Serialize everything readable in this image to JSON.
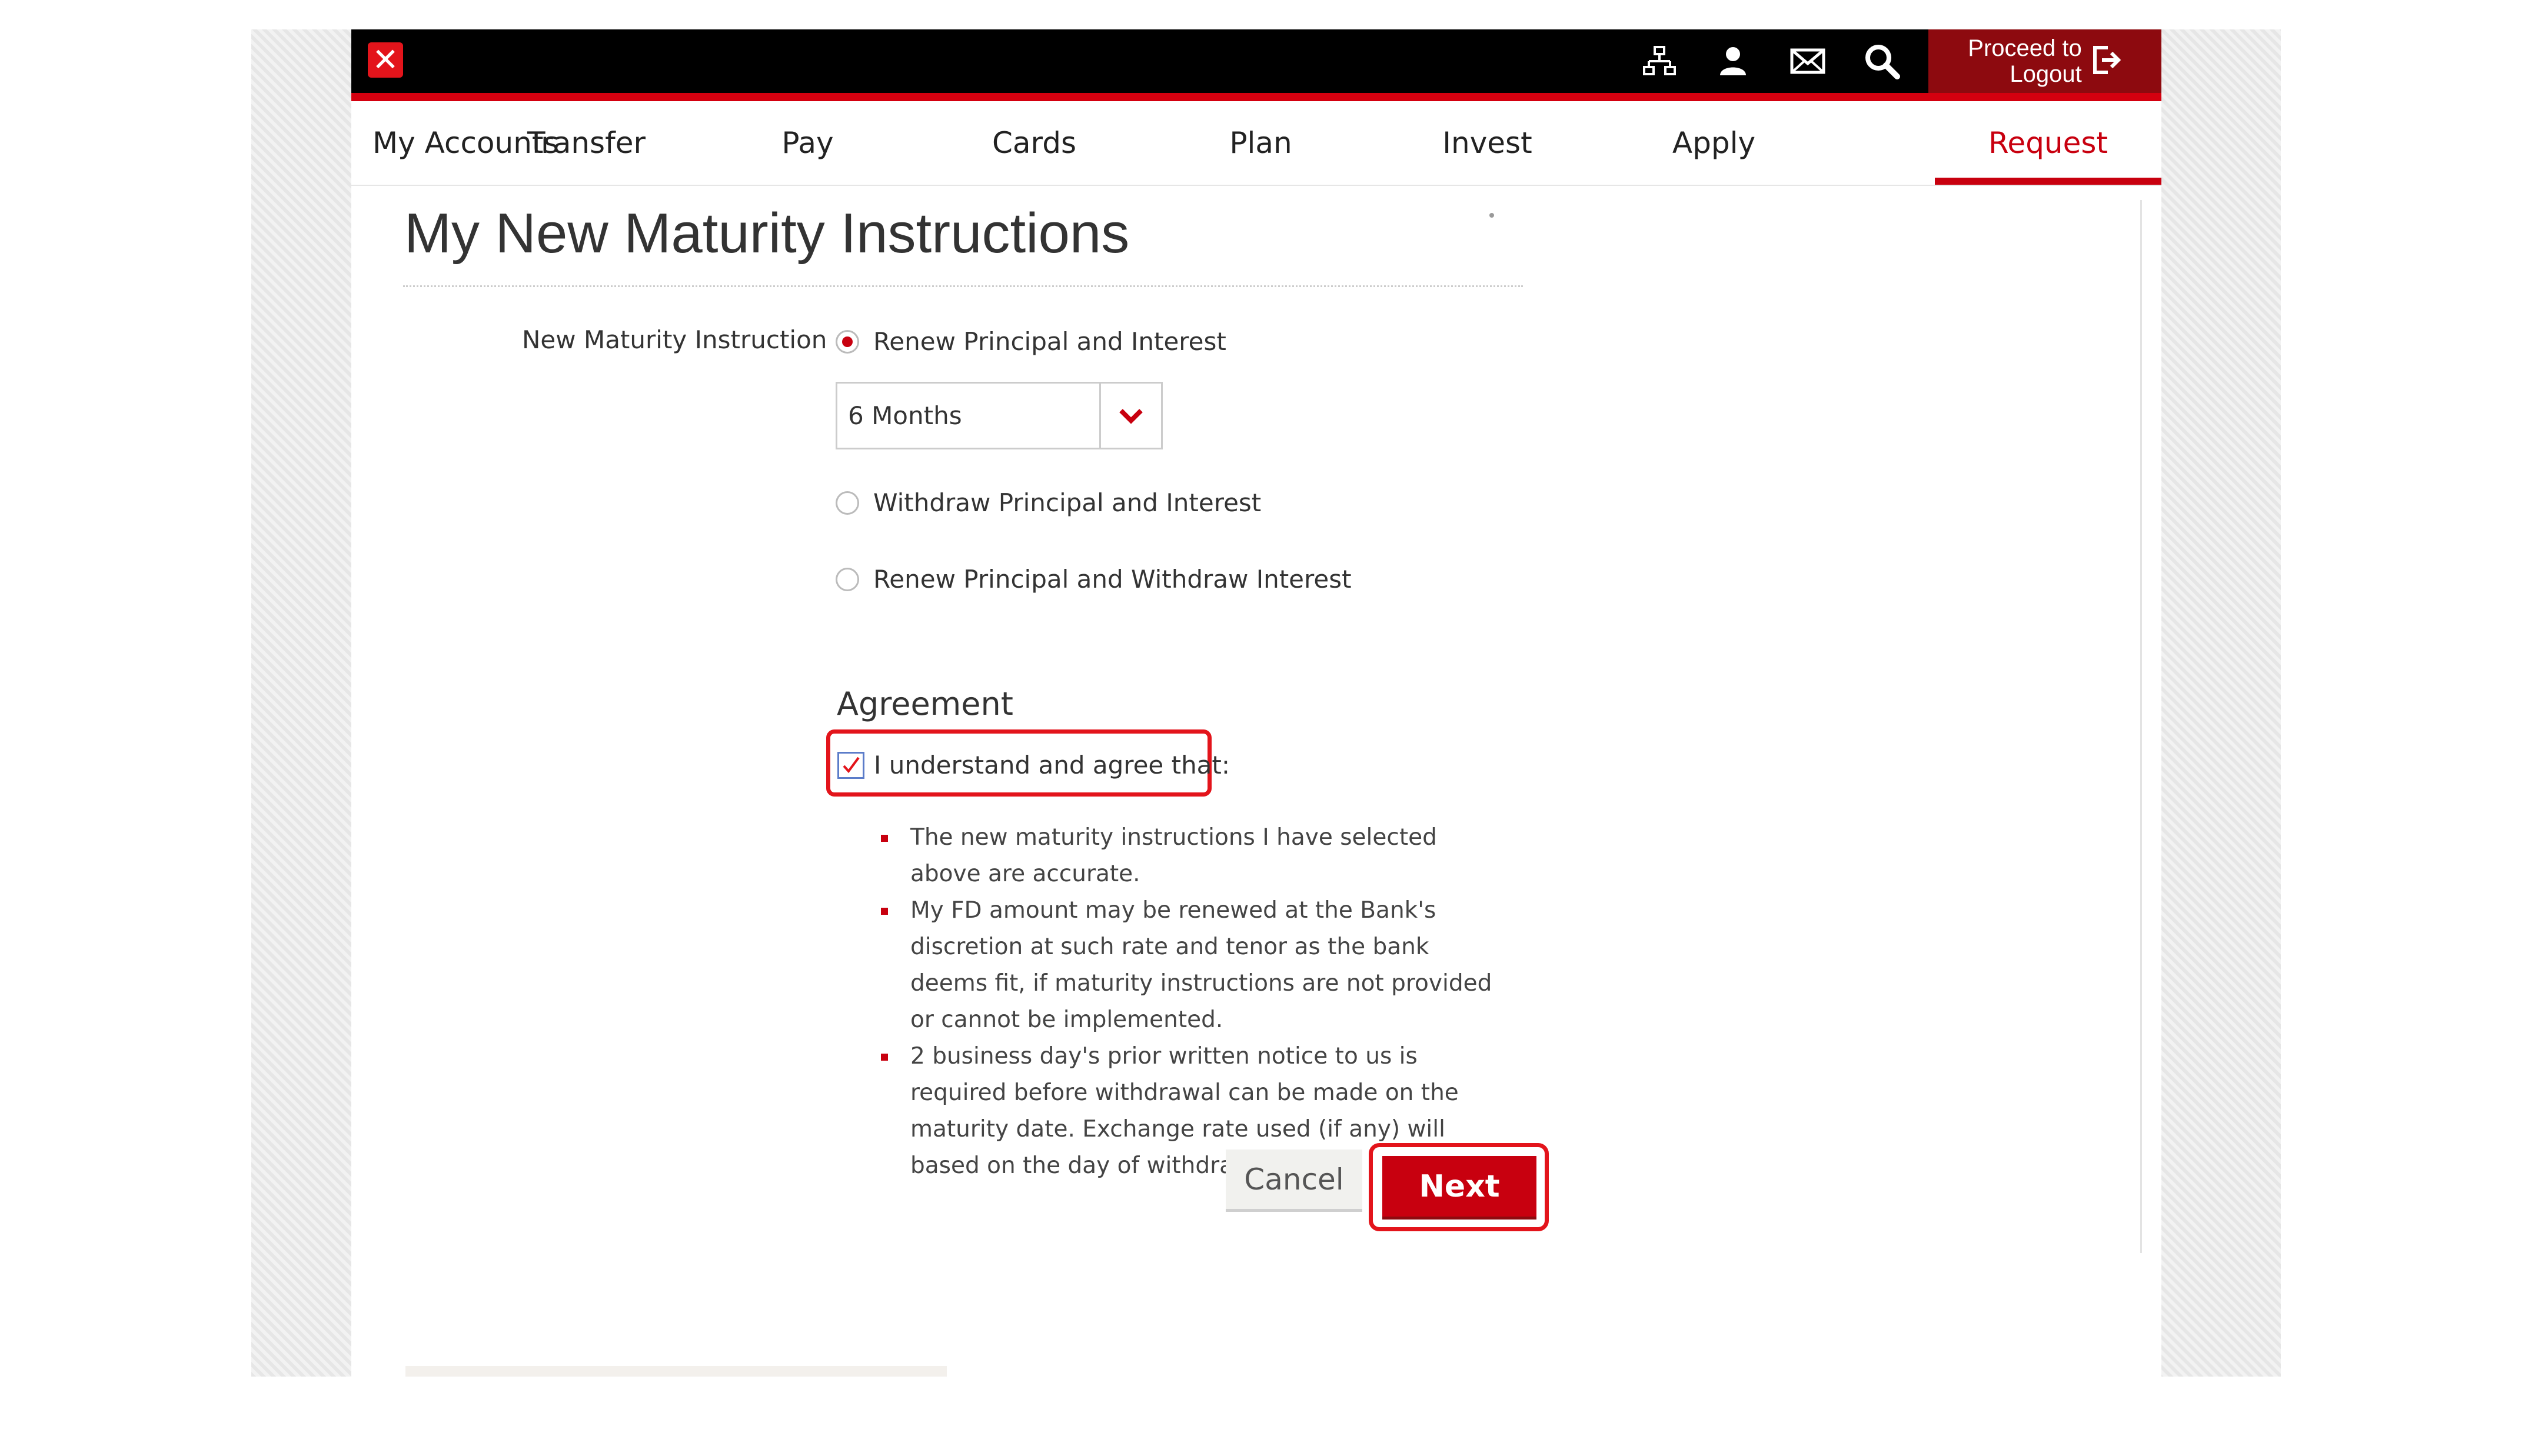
{
  "header": {
    "logout_label_line1": "Proceed to",
    "logout_label_line2": "Logout",
    "icons": [
      "sitemap-icon",
      "user-icon",
      "mail-icon",
      "search-icon",
      "logout-icon"
    ]
  },
  "nav": {
    "items": [
      {
        "label": "My Accounts"
      },
      {
        "label": "Transfer"
      },
      {
        "label": "Pay"
      },
      {
        "label": "Cards"
      },
      {
        "label": "Plan"
      },
      {
        "label": "Invest"
      },
      {
        "label": "Apply"
      },
      {
        "label": "Request",
        "active": true
      }
    ]
  },
  "main": {
    "title": "My New Maturity Instructions",
    "field_label": "New Maturity Instruction",
    "options": [
      {
        "label": "Renew Principal and Interest",
        "selected": true
      },
      {
        "label": "Withdraw Principal and Interest",
        "selected": false
      },
      {
        "label": "Renew Principal and Withdraw Interest",
        "selected": false
      }
    ],
    "tenor_select": {
      "value": "6 Months"
    },
    "agreement": {
      "heading": "Agreement",
      "checkbox_label": "I understand and agree that:",
      "checked": true,
      "terms": [
        "The new maturity instructions I have selected above are accurate.",
        "My FD amount may be renewed at the Bank's discretion at such rate and tenor as the bank deems fit, if maturity instructions are not provided or cannot be implemented.",
        "2 business day's prior written notice to us is required before withdrawal can be made on the maturity date. Exchange rate used (if any) will based on the day of withdrawal."
      ]
    },
    "buttons": {
      "cancel": "Cancel",
      "next": "Next"
    }
  },
  "colors": {
    "brand_red": "#c8000f",
    "highlight_red": "#e3141b",
    "logout_bg": "#8d0a0f",
    "topbar": "#000000"
  }
}
